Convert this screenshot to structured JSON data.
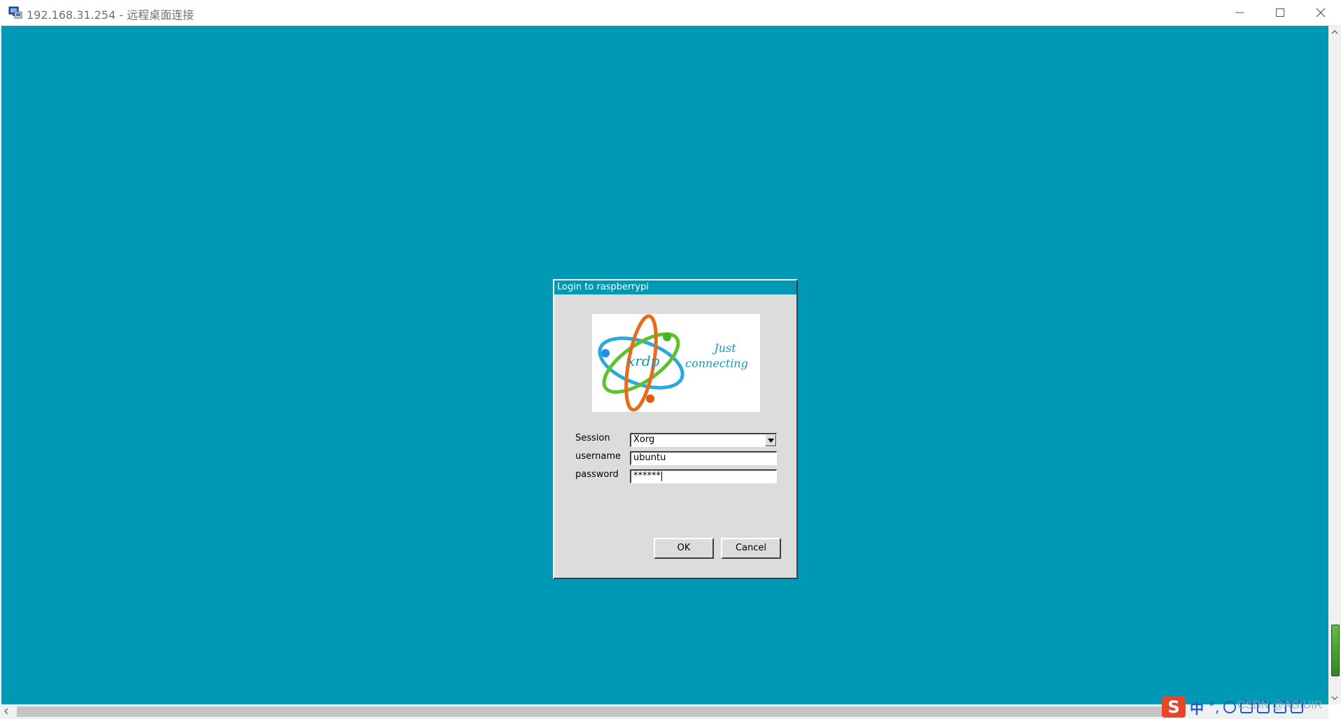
{
  "window": {
    "title": "192.168.31.254 - 远程桌面连接",
    "icon": "remote-desktop-icon",
    "controls": [
      "minimize-icon",
      "maximize-icon",
      "close-icon"
    ]
  },
  "desktop": {
    "background_color": "#0099b5"
  },
  "dialog": {
    "title": "Login to raspberrypi",
    "logo": {
      "brand": "xrdp",
      "tagline_line1": "Just",
      "tagline_line2": "connecting"
    },
    "session": {
      "label": "Session",
      "value": "Xorg"
    },
    "username": {
      "label": "username",
      "value": "ubuntu"
    },
    "password": {
      "label": "password",
      "value": "******"
    },
    "ok_label": "OK",
    "cancel_label": "Cancel"
  },
  "ime": {
    "logo": "S",
    "mode": "中",
    "punct": "°,",
    "watermark": "CSDN @AGIUIR"
  }
}
